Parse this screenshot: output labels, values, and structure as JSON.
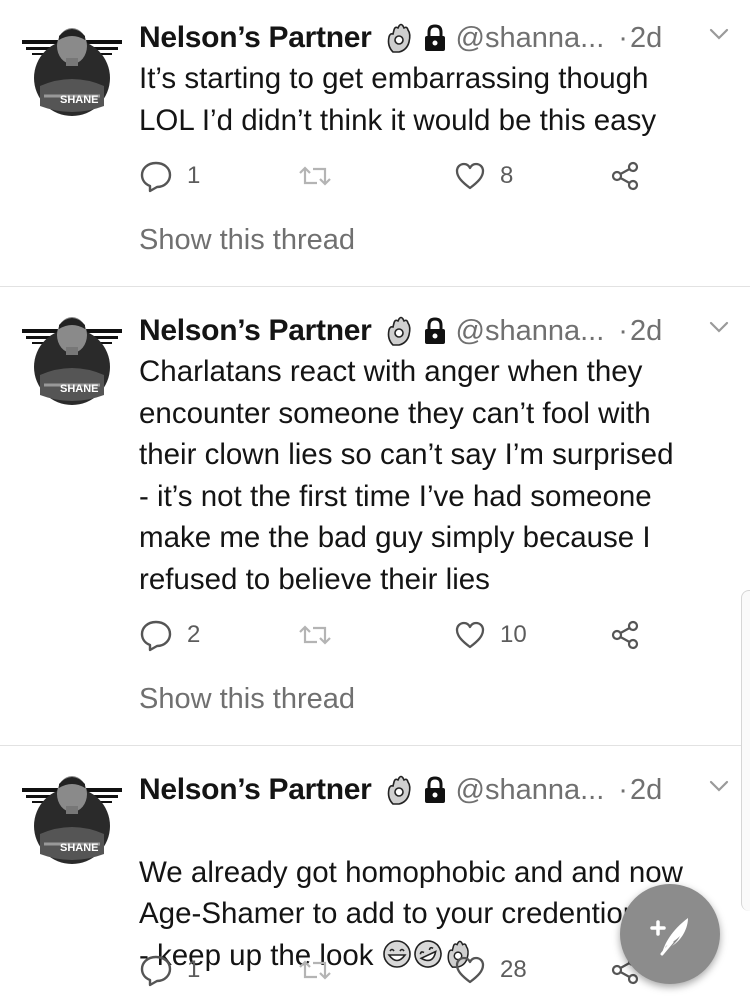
{
  "tweets": [
    {
      "author_name": "Nelson’s Partner",
      "handle": "@shanna...",
      "time": "2d",
      "avatar_label": "SHANE",
      "text": "It’s starting to get embarrassing though\nLOL I’d didn’t think it would be this easy",
      "replies": "1",
      "retweets": "",
      "likes": "8",
      "show_thread": "Show this thread"
    },
    {
      "author_name": "Nelson’s Partner",
      "handle": "@shanna...",
      "time": "2d",
      "avatar_label": "SHANE",
      "text": "Charlatans react with anger when they\nencounter someone they can’t fool with\ntheir clown lies so can’t say I’m surprised\n- it’s not the first time I’ve had someone\nmake me the bad guy simply because I\nrefused to believe their lies",
      "replies": "2",
      "retweets": "",
      "likes": "10",
      "show_thread": "Show this thread"
    },
    {
      "author_name": "Nelson’s Partner",
      "handle": "@shanna...",
      "time": "2d",
      "avatar_label": "SHANE",
      "text": "We already got homophobic and and now\nAge-Shamer to add to your credentionals\n- keep up the look",
      "replies": "1",
      "retweets": "",
      "likes": "28",
      "show_thread": ""
    }
  ],
  "separator": "·",
  "icons": {
    "header": [
      "ok-hand-emoji-icon",
      "lock-icon",
      "chevron-down-icon"
    ],
    "actions": [
      "reply-icon",
      "retweet-icon",
      "like-icon",
      "share-icon"
    ],
    "trailing_emoji": [
      "grinning-sweat-emoji-icon",
      "rofl-emoji-icon",
      "ok-hand-emoji-icon"
    ],
    "fab": "compose-tweet-icon"
  }
}
